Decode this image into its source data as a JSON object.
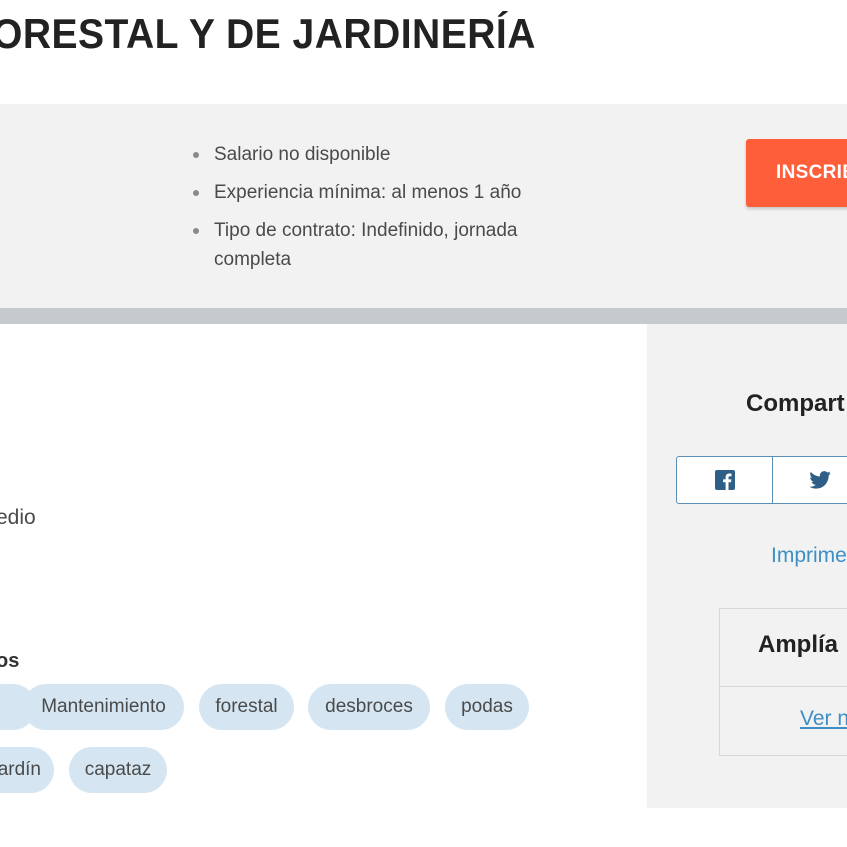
{
  "job": {
    "title": "ORESTAL Y DE JARDINERÍA"
  },
  "summary": {
    "items": [
      "Salario no disponible",
      "Experiencia mínima: al menos 1 año",
      "Tipo de contrato: Indefinido, jornada completa"
    ],
    "apply_label": "INSCRIB"
  },
  "details": {
    "fragment_text": "edio"
  },
  "skills": {
    "heading": "os",
    "tags": [
      "",
      "Mantenimiento",
      "forestal",
      "desbroces",
      "podas",
      "ardín",
      "capataz"
    ]
  },
  "sidebar": {
    "share_heading": "Compart",
    "share_icons": [
      "facebook-icon",
      "twitter-icon"
    ],
    "print_label": "Imprime",
    "expand_heading": "Amplía",
    "expand_link": "Ver n"
  },
  "colors": {
    "accent": "#ff5e3a",
    "link": "#3d8fc4",
    "tag_bg": "#d5e6f2",
    "band_bg": "#f2f2f2",
    "social_blue": "#2f5f86"
  }
}
